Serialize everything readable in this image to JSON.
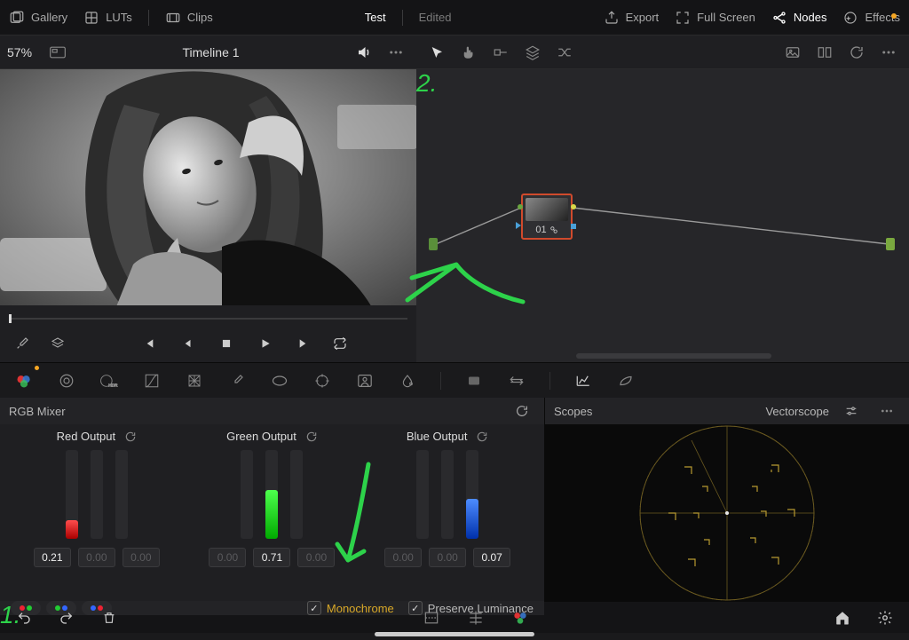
{
  "topbar": {
    "left": {
      "gallery": "Gallery",
      "luts": "LUTs",
      "clips": "Clips"
    },
    "center": {
      "title": "Test",
      "subtitle": "Edited"
    },
    "right": {
      "export": "Export",
      "fullscreen": "Full Screen",
      "nodes": "Nodes",
      "effects": "Effects"
    }
  },
  "viewer": {
    "zoom": "57%",
    "timeline": "Timeline 1"
  },
  "node": {
    "label": "01"
  },
  "rgbmixer": {
    "title": "RGB Mixer",
    "red": {
      "title": "Red Output",
      "values": [
        "0.21",
        "0.00",
        "0.00"
      ],
      "fill": [
        21,
        2,
        2
      ],
      "active": 0
    },
    "green": {
      "title": "Green Output",
      "values": [
        "0.00",
        "0.71",
        "0.00"
      ],
      "fill": [
        2,
        55,
        2
      ],
      "active": 1
    },
    "blue": {
      "title": "Blue Output",
      "values": [
        "0.00",
        "0.00",
        "0.07"
      ],
      "fill": [
        2,
        2,
        45
      ],
      "active": 2
    },
    "monochrome": "Monochrome",
    "preserve": "Preserve Luminance"
  },
  "scopes": {
    "title": "Scopes",
    "mode": "Vectorscope"
  },
  "annotations": {
    "one": "1.",
    "two": "2."
  },
  "icons": {
    "gallery": "gallery-icon",
    "luts": "luts-icon",
    "clips": "clips-icon",
    "export": "export-icon",
    "fullscreen": "fullscreen-icon",
    "nodes": "nodes-icon",
    "effects": "effects-icon",
    "speaker": "speaker-icon",
    "dots": "dots-icon",
    "cursor": "cursor-icon",
    "hand": "hand-icon",
    "reset": "reset-icon",
    "home": "home-icon",
    "settings": "settings-icon",
    "undo": "undo-icon",
    "redo": "redo-icon",
    "trash": "trash-icon"
  }
}
